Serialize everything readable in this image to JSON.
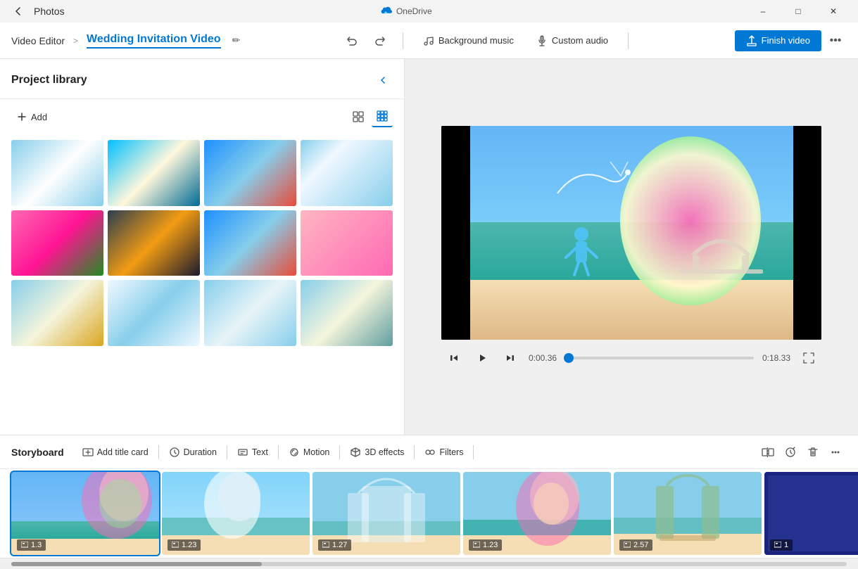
{
  "titlebar": {
    "app_name": "Photos",
    "back_icon": "←",
    "onedrive_label": "OneDrive",
    "minimize_label": "–",
    "maximize_label": "□",
    "close_label": "✕"
  },
  "toolbar": {
    "app_name": "Video Editor",
    "breadcrumb_sep": ">",
    "project_title": "Wedding Invitation Video",
    "edit_icon": "✏",
    "undo_icon": "↺",
    "redo_icon": "↻",
    "bg_music_label": "Background music",
    "bg_music_icon": "♪",
    "custom_audio_label": "Custom audio",
    "custom_audio_icon": "🎙",
    "finish_video_label": "Finish video",
    "finish_video_icon": "⬆",
    "more_icon": "•••"
  },
  "library": {
    "title": "Project library",
    "collapse_icon": "❮",
    "add_label": "Add",
    "add_icon": "+",
    "view_grid_large_icon": "⊞",
    "view_grid_small_icon": "⊟",
    "items": [
      {
        "id": 1,
        "class": "gi-1"
      },
      {
        "id": 2,
        "class": "gi-2"
      },
      {
        "id": 3,
        "class": "gi-3"
      },
      {
        "id": 4,
        "class": "gi-4"
      },
      {
        "id": 5,
        "class": "gi-5"
      },
      {
        "id": 6,
        "class": "gi-6"
      },
      {
        "id": 7,
        "class": "gi-7"
      },
      {
        "id": 8,
        "class": "gi-8"
      },
      {
        "id": 9,
        "class": "gi-9"
      },
      {
        "id": 10,
        "class": "gi-10"
      },
      {
        "id": 11,
        "class": "gi-11"
      },
      {
        "id": 12,
        "class": "gi-12"
      }
    ]
  },
  "player": {
    "rewind_icon": "⏮",
    "play_icon": "▶",
    "forward_icon": "⏭",
    "time_current": "0:00.36",
    "time_total": "0:18.33",
    "progress_pct": 2,
    "fullscreen_icon": "⛶"
  },
  "storyboard": {
    "title": "Storyboard",
    "add_title_card_label": "Add title card",
    "add_title_card_icon": "▣",
    "duration_label": "Duration",
    "duration_icon": "⏱",
    "text_label": "Text",
    "text_icon": "T",
    "motion_label": "Motion",
    "motion_icon": "◈",
    "effects_3d_label": "3D effects",
    "effects_3d_icon": "✦",
    "filters_label": "Filters",
    "filters_icon": "⧉",
    "split_icon": "⧓",
    "speed_icon": "⏩",
    "delete_icon": "🗑",
    "more_icon": "•••",
    "next_icon": "❯",
    "items": [
      {
        "id": 1,
        "duration": "1.3",
        "class": "story-item-1",
        "active": true
      },
      {
        "id": 2,
        "duration": "1.23",
        "class": "story-item-2",
        "active": false
      },
      {
        "id": 3,
        "duration": "1.27",
        "class": "story-item-3",
        "active": false
      },
      {
        "id": 4,
        "duration": "1.23",
        "class": "story-item-4",
        "active": false
      },
      {
        "id": 5,
        "duration": "2.57",
        "class": "story-item-5",
        "active": false
      },
      {
        "id": 6,
        "duration": "1",
        "class": "story-item-6",
        "active": false
      }
    ]
  }
}
